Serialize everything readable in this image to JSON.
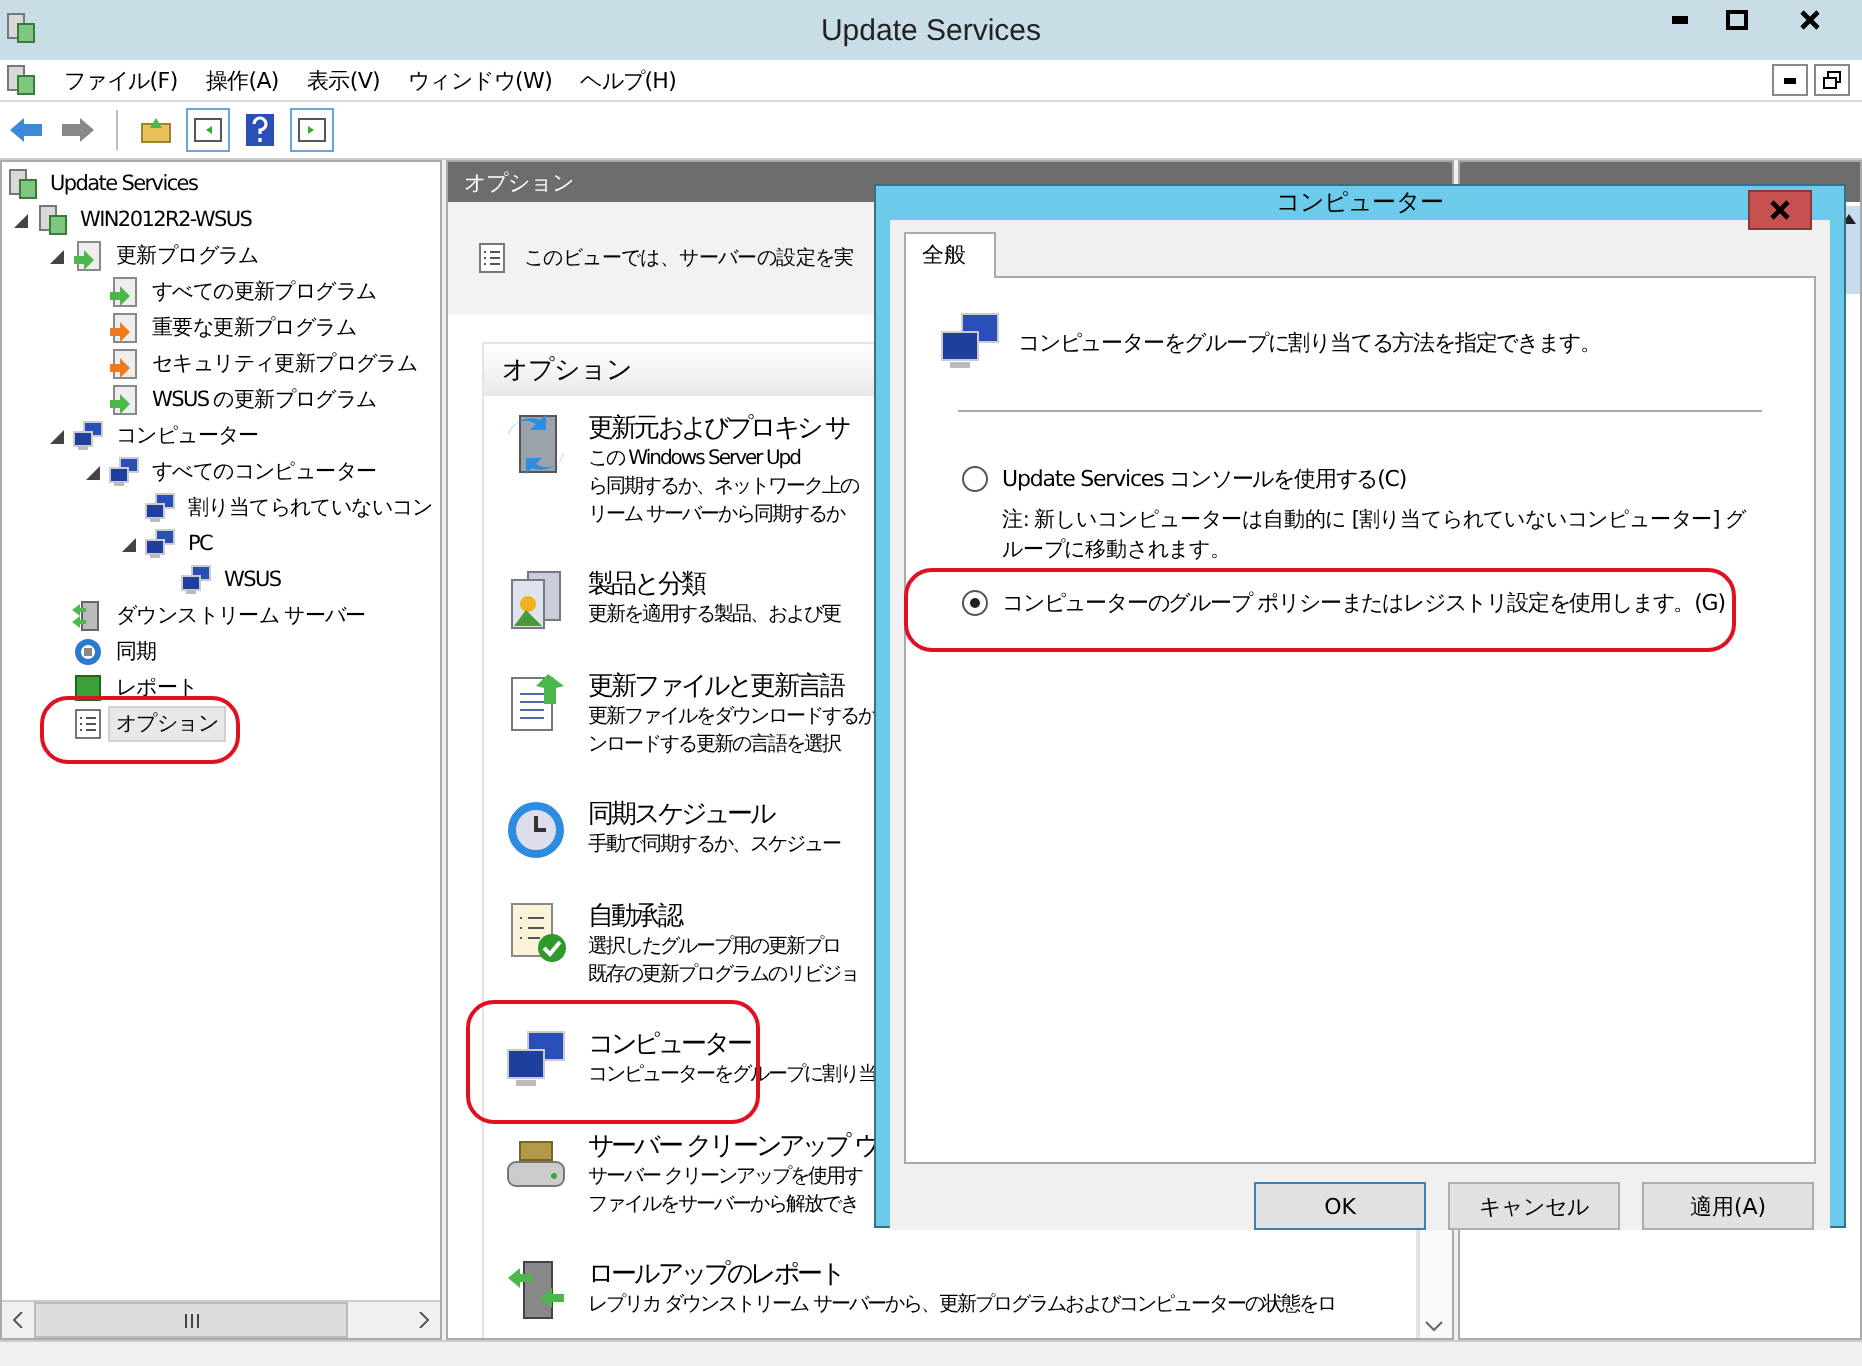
{
  "window": {
    "title": "Update Services"
  },
  "menu": [
    "ファイル(F)",
    "操作(A)",
    "表示(V)",
    "ウィンドウ(W)",
    "ヘルプ(H)"
  ],
  "tree": [
    {
      "label": "Update Services",
      "kind": "root",
      "selected": false,
      "children": [
        {
          "label": "WIN2012R2-WSUS",
          "kind": "server",
          "expanded": true,
          "selected": false,
          "children": [
            {
              "label": "更新プログラム",
              "kind": "updates",
              "expanded": true,
              "selected": false,
              "children": [
                {
                  "label": "すべての更新プログラム",
                  "kind": "updates",
                  "selected": false
                },
                {
                  "label": "重要な更新プログラム",
                  "kind": "critical",
                  "selected": false
                },
                {
                  "label": "セキュリティ更新プログラム",
                  "kind": "critical",
                  "selected": false
                },
                {
                  "label": "WSUS の更新プログラム",
                  "kind": "updates",
                  "selected": false
                }
              ]
            },
            {
              "label": "コンピューター",
              "kind": "computer",
              "expanded": true,
              "selected": false,
              "children": [
                {
                  "label": "すべてのコンピューター",
                  "kind": "computer",
                  "expanded": true,
                  "selected": false,
                  "children": [
                    {
                      "label": "割り当てられていないコン",
                      "kind": "computer",
                      "selected": false
                    },
                    {
                      "label": "PC",
                      "kind": "computer",
                      "expanded": true,
                      "selected": false,
                      "children": [
                        {
                          "label": "WSUS",
                          "kind": "computer",
                          "selected": false
                        }
                      ]
                    }
                  ]
                }
              ]
            },
            {
              "label": "ダウンストリーム サーバー",
              "kind": "downstream",
              "selected": false
            },
            {
              "label": "同期",
              "kind": "sync",
              "selected": false
            },
            {
              "label": "レポート",
              "kind": "report",
              "selected": false
            },
            {
              "label": "オプション",
              "kind": "options",
              "selected": true
            }
          ]
        }
      ]
    }
  ],
  "center": {
    "header": "オプション",
    "intro": "このビューでは、サーバーの設定を実",
    "section": "オプション",
    "options": [
      {
        "kind": "server",
        "title": "更新元およびプロキシ サ",
        "lines": [
          "この Windows Server Upd",
          "ら同期するか、ネットワーク上の",
          "リーム サーバーから同期するか"
        ]
      },
      {
        "kind": "products",
        "title": "製品と分類",
        "lines": [
          "更新を適用する製品、および更"
        ]
      },
      {
        "kind": "files",
        "title": "更新ファイルと更新言語",
        "lines": [
          "更新ファイルをダウンロードするか",
          "ンロードする更新の言語を選択"
        ]
      },
      {
        "kind": "schedule",
        "title": "同期スケジュール",
        "lines": [
          "手動で同期するか、スケジュー"
        ]
      },
      {
        "kind": "approval",
        "title": "自動承認",
        "lines": [
          "選択したグループ用の更新プロ",
          "既存の更新プログラムのリビジョ"
        ]
      },
      {
        "kind": "computer",
        "title": "コンピューター",
        "lines": [
          "コンピューターをグループに割り当"
        ]
      },
      {
        "kind": "cleanup",
        "title": "サーバー クリーンアップ ウ",
        "lines": [
          "サーバー クリーンアップを使用す",
          "ファイルをサーバーから解放でき"
        ]
      },
      {
        "kind": "rollup",
        "title": "ロールアップのレポート",
        "lines": [
          "レプリカ ダウンストリーム サーバーから、更新プログラムおよびコンピューターの状態をロ"
        ]
      }
    ]
  },
  "dialog": {
    "title": "コンピューター",
    "tabs": [
      {
        "label": "全般",
        "selected": true
      }
    ],
    "description": "コンピューターをグループに割り当てる方法を指定できます。",
    "radios": [
      {
        "label": "Update Services コンソールを使用する(C)",
        "note": "注: 新しいコンピューターは自動的に [割り当てられていないコンピューター] グループに移動されます。",
        "selected": false
      },
      {
        "label": "コンピューターのグループ ポリシーまたはレジストリ設定を使用します。(G)",
        "selected": true
      }
    ],
    "buttons": [
      {
        "label": "OK",
        "default": true
      },
      {
        "label": "キャンセル",
        "default": false
      },
      {
        "label": "適用(A)",
        "default": false
      }
    ]
  }
}
